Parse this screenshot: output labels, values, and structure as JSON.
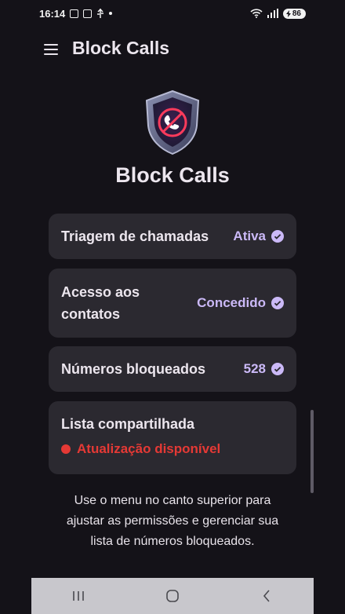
{
  "status_bar": {
    "time": "16:14",
    "battery": "86"
  },
  "app_bar": {
    "title": "Block Calls",
    "menu_icon": "menu-icon"
  },
  "hero": {
    "title": "Block Calls",
    "icon": "shield-blocked-phone-icon"
  },
  "cards": {
    "screening": {
      "label": "Triagem de chamadas",
      "status": "Ativa"
    },
    "contacts": {
      "label_line1": "Acesso aos",
      "label_line2": "contatos",
      "status": "Concedido"
    },
    "blocked": {
      "label": "Números bloqueados",
      "status": "528"
    },
    "shared_list": {
      "label": "Lista compartilhada",
      "status": "Atualização disponível"
    }
  },
  "hint": {
    "line1": "Use o menu no canto superior para",
    "line2": "ajustar as permissões e gerenciar sua",
    "line3": "lista de números bloqueados."
  },
  "colors": {
    "accent": "#cbb9f7",
    "warning": "#e53935",
    "card": "#2b2930",
    "background": "#141218"
  }
}
